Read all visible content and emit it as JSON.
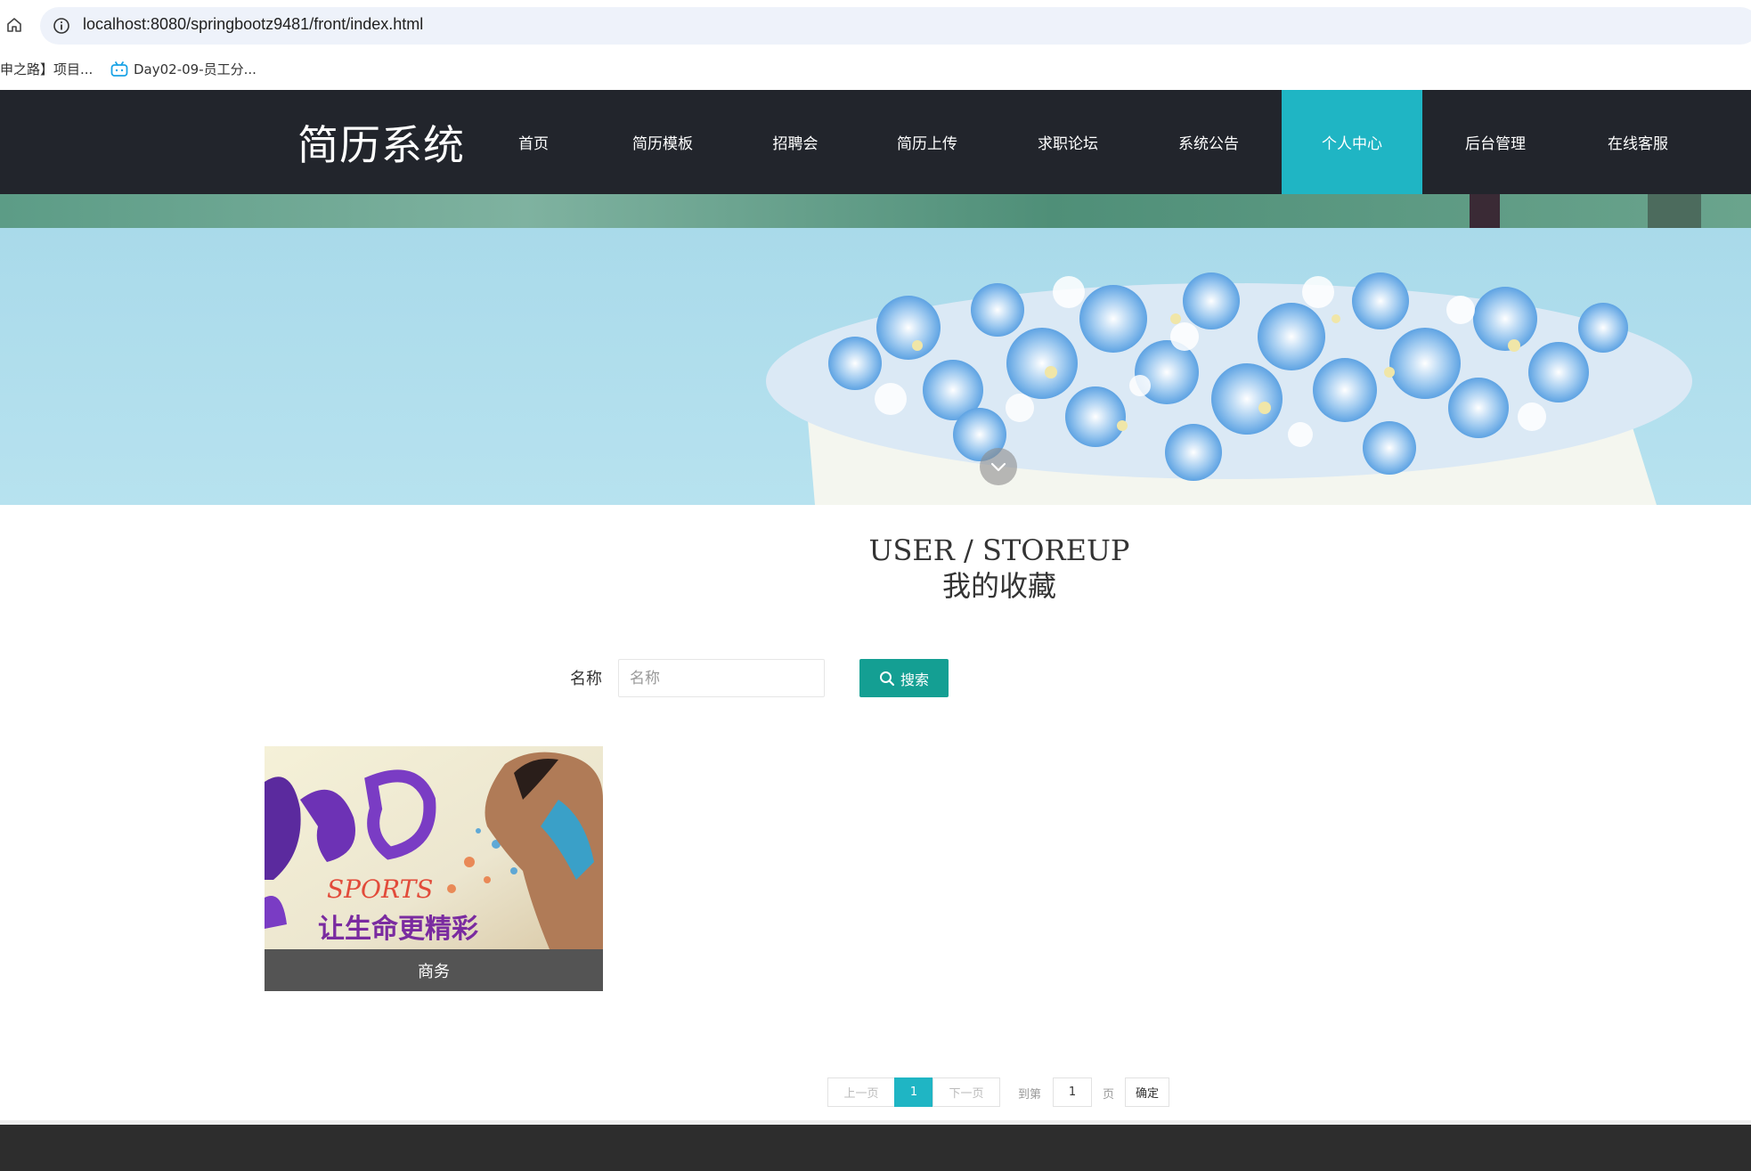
{
  "browser": {
    "url": "localhost:8080/springbootz9481/front/index.html",
    "bookmarks": [
      {
        "label": "申之路】项目..."
      },
      {
        "label": "Day02-09-员工分..."
      }
    ]
  },
  "nav": {
    "logo": "简历系统",
    "items": [
      {
        "label": "首页"
      },
      {
        "label": "简历模板"
      },
      {
        "label": "招聘会"
      },
      {
        "label": "简历上传"
      },
      {
        "label": "求职论坛"
      },
      {
        "label": "系统公告"
      },
      {
        "label": "个人中心",
        "active": true
      },
      {
        "label": "后台管理"
      },
      {
        "label": "在线客服"
      }
    ],
    "active_color": "#1fb5c4",
    "bg_color": "#22252c"
  },
  "page": {
    "title_en": "USER / STOREUP",
    "title_zh": "我的收藏"
  },
  "search": {
    "label": "名称",
    "placeholder": "名称",
    "value": "",
    "button_label": "搜索",
    "button_color": "#149f93"
  },
  "cards": [
    {
      "caption": "商务",
      "image_text_1": "SPORTS",
      "image_text_2": "让生命更精彩"
    }
  ],
  "pagination": {
    "prev_label": "上一页",
    "current_page": "1",
    "next_label": "下一页",
    "goto_label": "到第",
    "goto_value": "1",
    "page_unit": "页",
    "confirm_label": "确定"
  }
}
